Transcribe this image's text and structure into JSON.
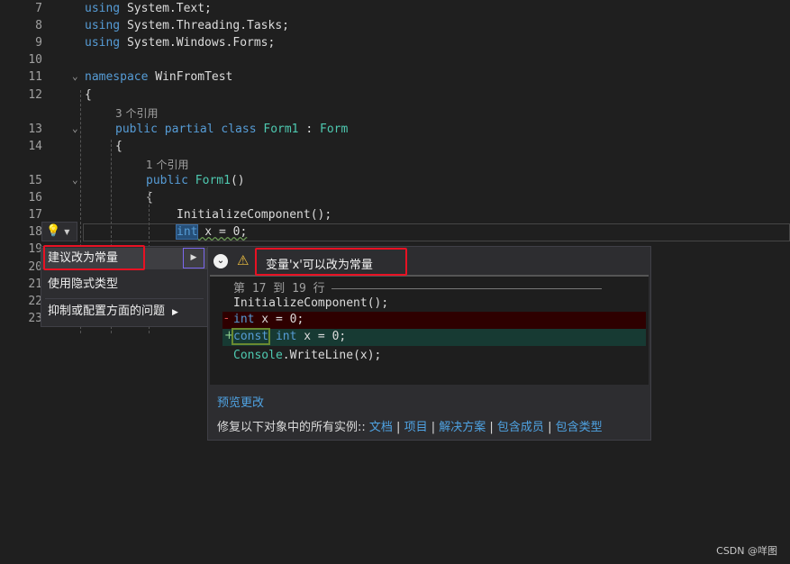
{
  "editor": {
    "lines": [
      {
        "n": "7",
        "parts": [
          [
            "kw",
            "using"
          ],
          [
            "tx",
            " System.Text;"
          ]
        ]
      },
      {
        "n": "8",
        "parts": [
          [
            "kw",
            "using"
          ],
          [
            "tx",
            " System.Threading.Tasks;"
          ]
        ]
      },
      {
        "n": "9",
        "parts": [
          [
            "kw",
            "using"
          ],
          [
            "tx",
            " System.Windows.Forms;"
          ]
        ]
      },
      {
        "n": "10",
        "parts": []
      },
      {
        "n": "11",
        "parts": [
          [
            "kw",
            "namespace"
          ],
          [
            "tx",
            " WinFromTest"
          ]
        ]
      },
      {
        "n": "12",
        "parts": [
          [
            "tx",
            "{"
          ]
        ]
      },
      {
        "lens": "3 个引用"
      },
      {
        "n": "13",
        "parts": [
          [
            "kw",
            "public partial class "
          ],
          [
            "ty",
            "Form1"
          ],
          [
            "tx",
            " : "
          ],
          [
            "ty",
            "Form"
          ]
        ]
      },
      {
        "n": "14",
        "parts": [
          [
            "tx",
            "{"
          ]
        ]
      },
      {
        "lens": "1 个引用"
      },
      {
        "n": "15",
        "parts": [
          [
            "kw",
            "public "
          ],
          [
            "ty",
            "Form1"
          ],
          [
            "tx",
            "()"
          ]
        ]
      },
      {
        "n": "16",
        "parts": [
          [
            "tx",
            "{"
          ]
        ]
      },
      {
        "n": "17",
        "parts": [
          [
            "tx",
            "InitializeComponent();"
          ]
        ]
      },
      {
        "n": "18",
        "parts": [
          [
            "kw",
            "int"
          ],
          [
            "tx",
            " x = 0;"
          ]
        ]
      },
      {
        "n": "19",
        "parts": []
      },
      {
        "n": "20",
        "parts": []
      },
      {
        "n": "21",
        "parts": []
      },
      {
        "n": "22",
        "parts": []
      },
      {
        "n": "23",
        "parts": []
      }
    ]
  },
  "quick_actions": {
    "items": [
      {
        "label": "建议改为常量"
      },
      {
        "label": "使用隐式类型"
      },
      {
        "label": "抑制或配置方面的问题"
      }
    ]
  },
  "preview": {
    "title": "变量'x'可以改为常量",
    "range": "第 17 到 19 行",
    "ctx1": "InitializeComponent();",
    "removed_kw": "int",
    "removed_rest": " x = 0;",
    "added_const": "const",
    "added_kw": " int",
    "added_rest": " x = 0;",
    "ctx2_type": "Console",
    "ctx2_rest": ".WriteLine(x);",
    "preview_changes": "预览更改",
    "fix_all_label": "修复以下对象中的所有实例::",
    "scopes": [
      "文档",
      "项目",
      "解决方案",
      "包含成员",
      "包含类型"
    ]
  },
  "watermark": "CSDN @咩图",
  "colors": {
    "keyword": "#569cd6",
    "type": "#4ec9b0",
    "removed_bg": "#2e0000",
    "added_bg": "#173a33",
    "highlight_box": "#e81123"
  }
}
